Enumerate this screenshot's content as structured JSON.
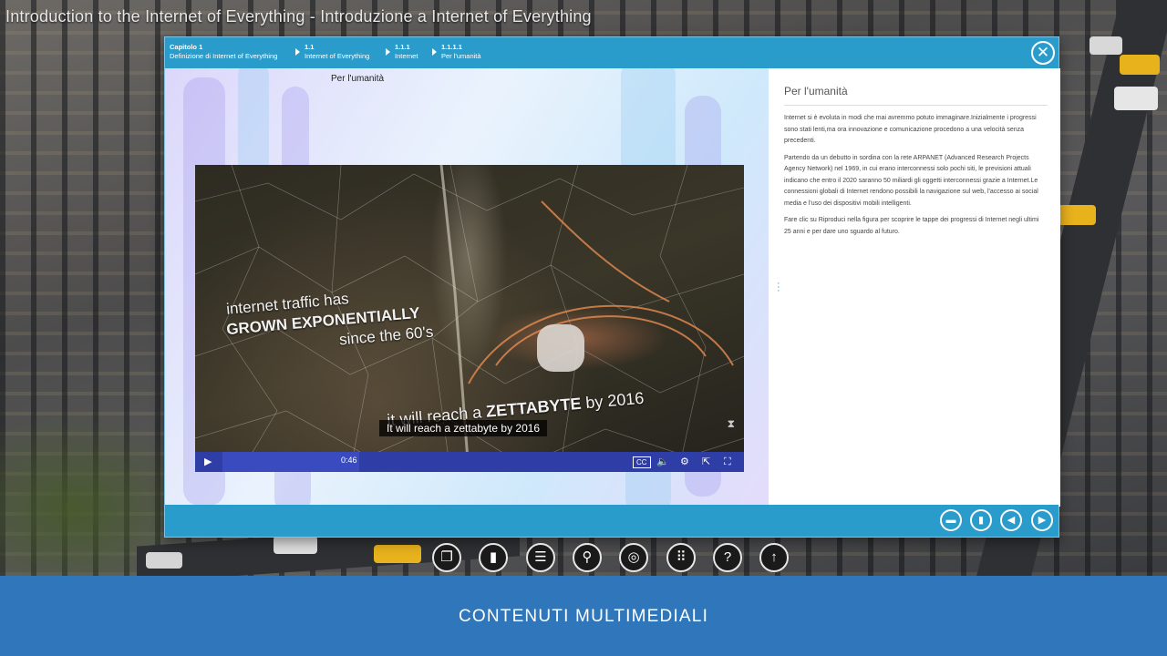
{
  "app_title": "Introduction to the Internet of Everything - Introduzione a Internet of Everything",
  "breadcrumbs": [
    {
      "num": "Capitolo 1",
      "label": "Definizione di Internet of Everything"
    },
    {
      "num": "1.1",
      "label": "Internet of Everything"
    },
    {
      "num": "1.1.1",
      "label": "Internet"
    },
    {
      "num": "1.1.1.1",
      "label": "Per l'umanità"
    }
  ],
  "slide": {
    "title": "Per l'umanità",
    "video": {
      "overlay_line1": "internet traffic has",
      "overlay_line2": "GROWN EXPONENTIALLY",
      "overlay_line3": "since the 60's",
      "overlay_line4_prefix": "it will reach a",
      "overlay_line4_bold": "ZETTABYTE",
      "overlay_line4_suffix": "by 2016",
      "subtitle": "It will reach a zettabyte by 2016",
      "time": "0:46",
      "controls": {
        "play": "play-icon",
        "cc": "CC"
      }
    }
  },
  "panel": {
    "title": "Per l'umanità",
    "paragraphs": [
      "Internet si è evoluta in modi che mai avremmo potuto immaginare.Inizialmente i progressi sono stati lenti,ma ora innovazione e comunicazione procedono a una velocità senza precedenti.",
      "Partendo da un debutto in sordina con la rete ARPANET (Advanced Research Projects Agency Network) nel 1969, in cui erano interconnessi solo pochi siti, le previsioni attuali indicano che entro il 2020 saranno 50 miliardi gli oggetti interconnessi grazie a Internet.Le connessioni globali di Internet rendono possibili la navigazione sul web, l'accesso ai social media e l'uso dei dispositivi mobili intelligenti.",
      "Fare clic su Riproduci nella figura per scoprire le tappe dei progressi di Internet negli ultimi 25 anni e per dare uno sguardo al futuro."
    ]
  },
  "footer": {
    "label": "CONTENUTI MULTIMEDIALI"
  },
  "colors": {
    "accent": "#2a9ccb",
    "footer": "#2f77ba",
    "video_bar": "#2f3ea6"
  }
}
